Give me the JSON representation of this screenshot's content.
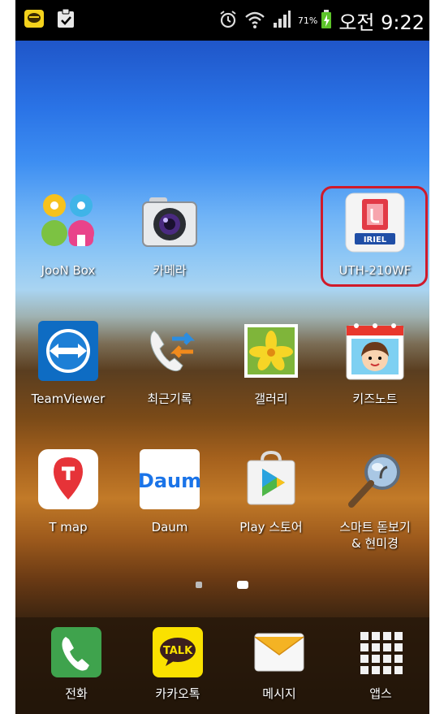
{
  "status": {
    "battery": "71%",
    "time": "오전 9:22",
    "icons": [
      "chat-notification-icon",
      "clipboard-notification-icon",
      "alarm-icon",
      "wifi-icon",
      "signal-icon",
      "battery-charging-icon"
    ]
  },
  "home": {
    "apps": [
      {
        "label": "JooN Box",
        "icon": "joon-box-icon"
      },
      {
        "label": "카메라",
        "icon": "camera-icon"
      },
      {
        "label": "UTH-210WF",
        "icon": "uth-210wf-icon",
        "badge": "IRIEL"
      },
      {
        "label": "TeamViewer",
        "icon": "teamviewer-icon"
      },
      {
        "label": "최근기록",
        "icon": "call-log-icon"
      },
      {
        "label": "갤러리",
        "icon": "gallery-icon"
      },
      {
        "label": "키즈노트",
        "icon": "kidsnote-icon"
      },
      {
        "label": "T map",
        "icon": "tmap-icon"
      },
      {
        "label": "Daum",
        "icon": "daum-icon",
        "logo": "Daum"
      },
      {
        "label": "Play 스토어",
        "icon": "play-store-icon"
      },
      {
        "label": "스마트 돋보기\n& 현미경",
        "line1": "스마트 돋보기",
        "line2": "& 현미경",
        "icon": "magnifier-icon"
      }
    ]
  },
  "pager": {
    "pages": 2,
    "current": 2
  },
  "dock": {
    "items": [
      {
        "label": "전화",
        "icon": "phone-icon"
      },
      {
        "label": "카카오톡",
        "icon": "kakaotalk-icon",
        "logo": "TALK"
      },
      {
        "label": "메시지",
        "icon": "message-icon"
      },
      {
        "label": "앱스",
        "icon": "apps-grid-icon"
      }
    ]
  },
  "colors": {
    "highlight": "#d01a2a",
    "kakao_yellow": "#fae100",
    "phone_green": "#3fa34d"
  }
}
